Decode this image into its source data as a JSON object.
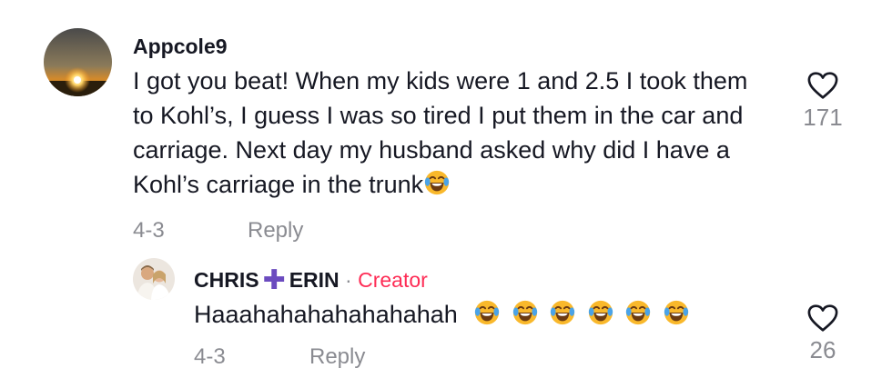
{
  "comment": {
    "username": "Appcole9",
    "text": "I got you beat! When my kids were 1 and 2.5 I took them to Kohl’s, I guess I was so tired I put them in the car and carriage. Next day my husband asked why did I have a Kohl’s carriage in the trunk",
    "date": "4-3",
    "reply_label": "Reply",
    "likes": "171",
    "trailing_emoji": "face-with-tears-of-joy"
  },
  "reply": {
    "username_part1": "CHRIS",
    "username_plus": "✚",
    "username_part2": "ERIN",
    "separator": "·",
    "creator_label": "Creator",
    "text": "Haaahahahahahahahah",
    "emoji_count": 6,
    "emoji": "face-with-tears-of-joy",
    "date": "4-3",
    "reply_label": "Reply",
    "likes": "26"
  },
  "colors": {
    "text": "#161823",
    "muted": "#8a8b91",
    "creator": "#fe2c55",
    "plus": "#6b4bbf"
  }
}
